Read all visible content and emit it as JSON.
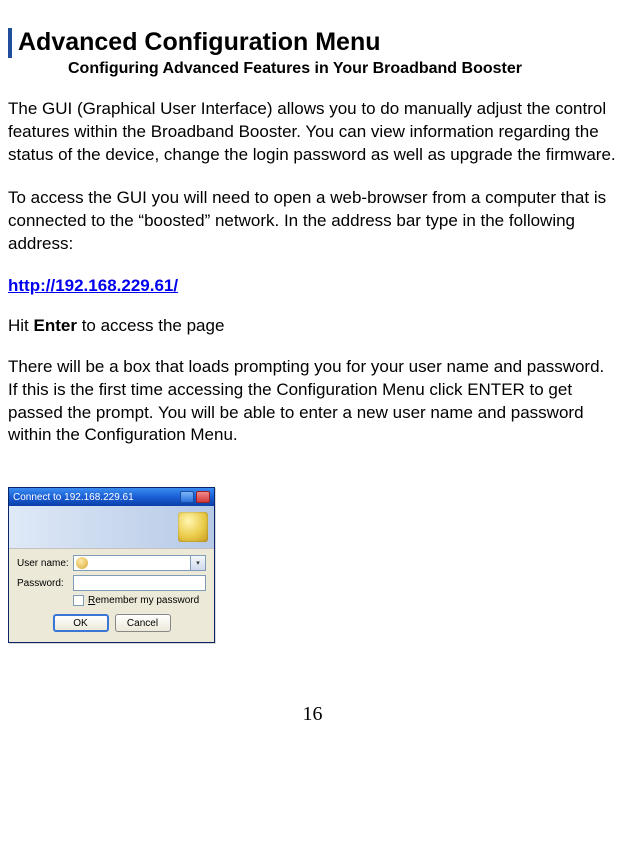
{
  "heading": "Advanced Configuration Menu",
  "subheading": "Configuring Advanced Features in Your Broadband Booster",
  "para1": "The GUI (Graphical User Interface) allows you to do manually adjust the control features within the Broadband Booster.  You can view information regarding the status of the device, change the login password as well as upgrade the firmware.",
  "para2": "To access the GUI you will need to open a web-browser from a computer that is connected to the “boosted” network.  In the address bar type in the following address:",
  "url": "http://192.168.229.61/",
  "hit_prefix": "Hit ",
  "hit_bold": "Enter",
  "hit_suffix": " to access the page",
  "para3": "There will be a box that loads prompting you for your user name and password.  If this is the first time accessing the Configuration Menu click ENTER to get passed the prompt.  You will be able to enter a new user name and password within the Configuration Menu.",
  "dialog": {
    "title": "Connect to 192.168.229.61",
    "username_label": "User name:",
    "password_label": "Password:",
    "username_value": "",
    "password_value": "",
    "remember_prefix": "R",
    "remember_rest": "emember my password",
    "ok": "OK",
    "cancel": "Cancel"
  },
  "page_number": "16"
}
